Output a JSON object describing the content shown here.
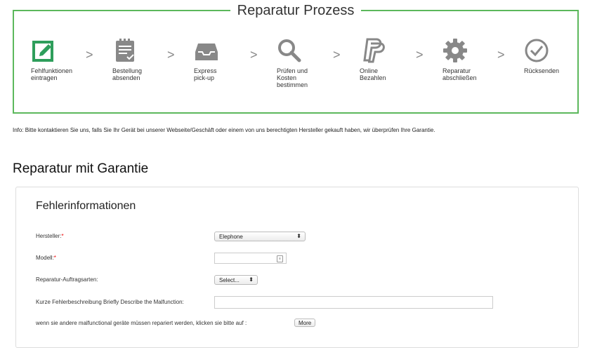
{
  "process": {
    "title": "Reparatur Prozess",
    "steps": [
      {
        "label": "Fehlfunktionen\neintragen",
        "icon": "edit-icon"
      },
      {
        "label": "Bestellung\nabsenden",
        "icon": "clipboard-icon"
      },
      {
        "label": "Express\npick-up",
        "icon": "inbox-tray-icon"
      },
      {
        "label": "Prüfen und\nKosten\nbestimmen",
        "icon": "search-icon"
      },
      {
        "label": "Online\nBezahlen",
        "icon": "paypal-icon"
      },
      {
        "label": "Reparatur\nabschließen",
        "icon": "gear-icon"
      },
      {
        "label": "Rücksenden",
        "icon": "checkmark-circle-icon"
      }
    ],
    "chevron": ">"
  },
  "info_text": "Info: Bitte kontaktieren Sie uns, falls Sie Ihr Gerät bei unserer Webseite/Geschäft oder einem von uns berechtigten Hersteller gekauft haben, wir überprüfen Ihre Garantie.",
  "section_title": "Reparatur mit Garantie",
  "form": {
    "title": "Fehlerinformationen",
    "manufacturer_label": "Hersteller:",
    "manufacturer_value": "Elephone",
    "required_mark": "*",
    "model_label": "Modell:",
    "model_value": "",
    "repair_type_label": "Reparatur-Auftragsarten:",
    "repair_type_value": "Select...",
    "description_label": "Kurze Fehlerbeschreibung Briefly Describe the Malfunction:",
    "description_value": "",
    "more_text": "wenn sie andere malfunctional geräte müssen repariert werden, klicken sie bitte auf :",
    "more_button": "More"
  },
  "colors": {
    "accent": "#5cb85c",
    "icon_green": "#2e9e5b",
    "icon_gray": "#888888",
    "required": "#ee0000"
  }
}
